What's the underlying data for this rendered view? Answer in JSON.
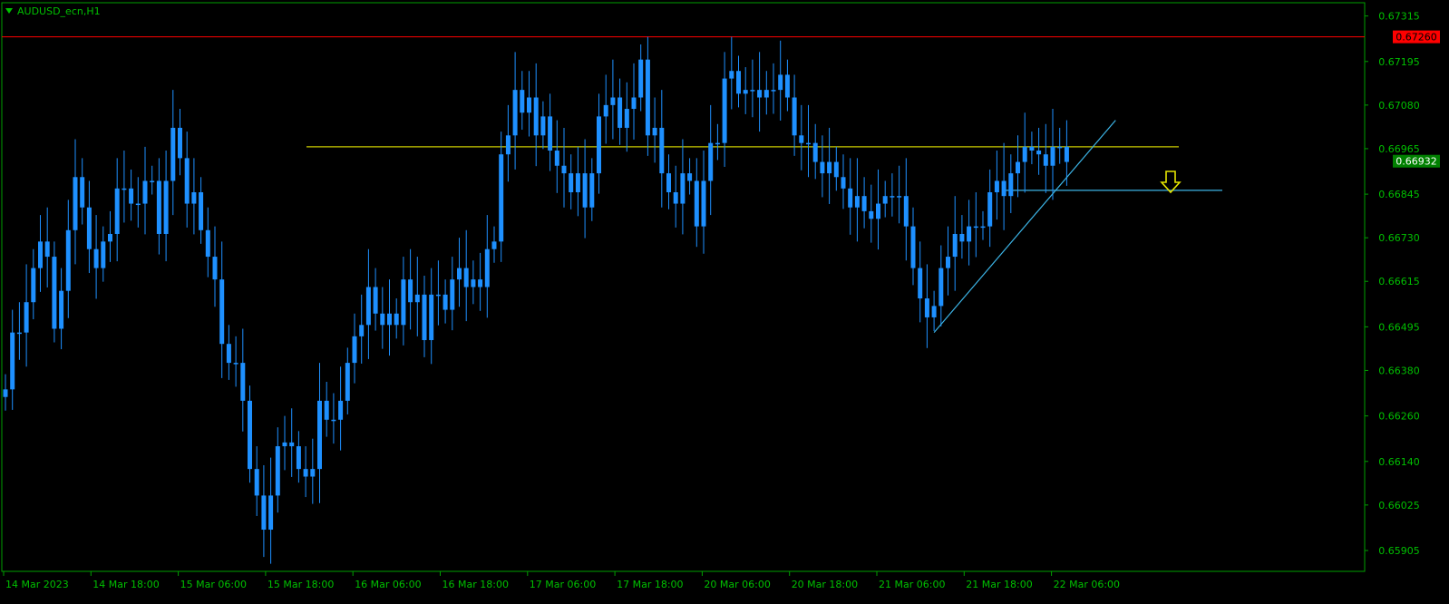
{
  "title": "AUDUSD_ecn,H1",
  "colors": {
    "background": "#000000",
    "frame": "#00a000",
    "text": "#00c000",
    "candle": "#1e90ff",
    "resistance_line": "#ff0000",
    "horizontal_line": "#c8c800",
    "trend_line": "#3cb4e6",
    "current_price_label_bg": "#008000",
    "resistance_label_bg": "#ff0000",
    "arrow": "#e6e600"
  },
  "chart_data": {
    "type": "candlestick",
    "timeframe": "H1",
    "symbol": "AUDUSD_ecn",
    "ylim": [
      0.6585,
      0.6735
    ],
    "y_ticks": [
      "0.67315",
      "0.67195",
      "0.67080",
      "0.66965",
      "0.66845",
      "0.66730",
      "0.66615",
      "0.66495",
      "0.66380",
      "0.66260",
      "0.66140",
      "0.66025",
      "0.65905"
    ],
    "x_ticks": [
      "14 Mar 2023",
      "14 Mar 18:00",
      "15 Mar 06:00",
      "15 Mar 18:00",
      "16 Mar 06:00",
      "16 Mar 18:00",
      "17 Mar 06:00",
      "17 Mar 18:00",
      "20 Mar 06:00",
      "20 Mar 18:00",
      "21 Mar 06:00",
      "21 Mar 18:00",
      "22 Mar 06:00"
    ],
    "resistance_level": "0.67260",
    "current_price": "0.66932",
    "horizontal_levels": [
      0.6697,
      0.66855
    ],
    "trend_line": {
      "from_close_index": 133,
      "from_price": 0.6648,
      "to_close_index": 159,
      "to_price": 0.6704
    },
    "sell_arrow": true,
    "closes": [
      0.6633,
      0.6648,
      0.6648,
      0.6656,
      0.6665,
      0.6672,
      0.6668,
      0.6649,
      0.6659,
      0.6675,
      0.6689,
      0.6681,
      0.667,
      0.6665,
      0.6672,
      0.6674,
      0.6686,
      0.6686,
      0.6682,
      0.6682,
      0.6688,
      0.6688,
      0.6674,
      0.6688,
      0.6702,
      0.6694,
      0.6682,
      0.6685,
      0.6675,
      0.6668,
      0.6662,
      0.6645,
      0.664,
      0.664,
      0.663,
      0.6612,
      0.6605,
      0.6596,
      0.6605,
      0.6618,
      0.6619,
      0.6618,
      0.6612,
      0.661,
      0.6612,
      0.663,
      0.6625,
      0.6625,
      0.663,
      0.664,
      0.6647,
      0.665,
      0.666,
      0.6653,
      0.665,
      0.6653,
      0.665,
      0.6662,
      0.6656,
      0.6658,
      0.6646,
      0.6658,
      0.6658,
      0.6654,
      0.6662,
      0.6665,
      0.666,
      0.6662,
      0.666,
      0.667,
      0.6672,
      0.6695,
      0.67,
      0.6712,
      0.6706,
      0.671,
      0.67,
      0.6705,
      0.6696,
      0.6692,
      0.669,
      0.6685,
      0.669,
      0.6681,
      0.669,
      0.6705,
      0.6708,
      0.671,
      0.6702,
      0.6707,
      0.671,
      0.672,
      0.67,
      0.6702,
      0.669,
      0.6685,
      0.6682,
      0.669,
      0.6688,
      0.6676,
      0.6688,
      0.6698,
      0.6698,
      0.6715,
      0.6717,
      0.6711,
      0.6712,
      0.6712,
      0.671,
      0.6712,
      0.6712,
      0.6716,
      0.671,
      0.67,
      0.6698,
      0.6698,
      0.6693,
      0.669,
      0.6693,
      0.6689,
      0.6686,
      0.6681,
      0.6684,
      0.668,
      0.6678,
      0.6682,
      0.6684,
      0.6684,
      0.6684,
      0.6676,
      0.6665,
      0.6657,
      0.6652,
      0.6655,
      0.6665,
      0.6668,
      0.6674,
      0.6672,
      0.6676,
      0.6676,
      0.6676,
      0.6685,
      0.6688,
      0.6684,
      0.669,
      0.6693,
      0.6697,
      0.6696,
      0.6695,
      0.6692,
      0.6697,
      0.6697,
      0.6693
    ]
  }
}
